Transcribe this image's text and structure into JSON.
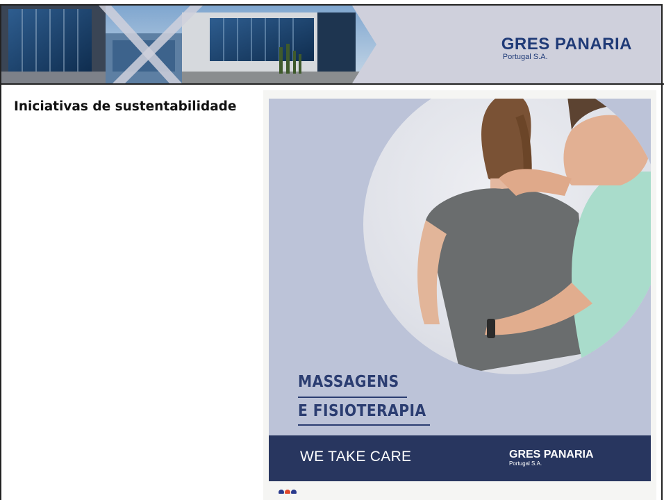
{
  "header": {
    "logo_title": "GRES PANARIA",
    "logo_subtitle": "Portugal S.A."
  },
  "section": {
    "heading": "Iniciativas de sustentabilidade"
  },
  "poster": {
    "title_line1": "MASSAGENS",
    "title_line2": "E FISIOTERAPIA",
    "tagline": "WE TAKE CARE",
    "logo_title": "GRES PANARIA",
    "logo_subtitle": "Portugal S.A."
  },
  "colors": {
    "brand_navy": "#28365f",
    "logo_blue": "#1f3a77",
    "poster_bg": "#bcc3d8",
    "banner_bg": "#cfd0dc"
  }
}
